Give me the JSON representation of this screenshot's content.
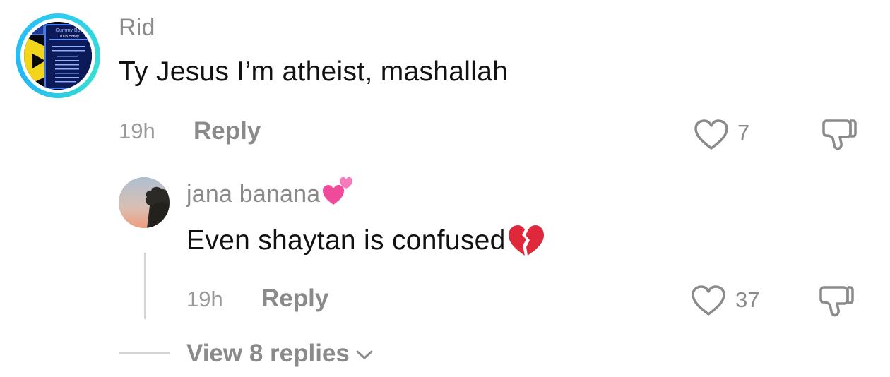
{
  "comment": {
    "avatar": {
      "label": "Gummy Bod",
      "sublabel": "100B Honey"
    },
    "username": "Rid",
    "text": "Ty Jesus I’m atheist, mashallah",
    "time": "19h",
    "reply_label": "Reply",
    "likes": "7",
    "icons": [
      "heart-outline-icon",
      "dislike-icon"
    ]
  },
  "reply": {
    "username": "jana banana",
    "username_emoji": "two-hearts-emoji",
    "text": "Even shaytan is confused",
    "text_emoji": "broken-heart-emoji",
    "time": "19h",
    "reply_label": "Reply",
    "likes": "37"
  },
  "view_replies": {
    "label": "View 8 replies"
  },
  "colors": {
    "ring": "#2ecbf0",
    "muted_text": "#8a8a8a",
    "primary_text": "#111111",
    "heart_pink": "#f04a9a",
    "broken_heart_red": "#e0283c"
  }
}
